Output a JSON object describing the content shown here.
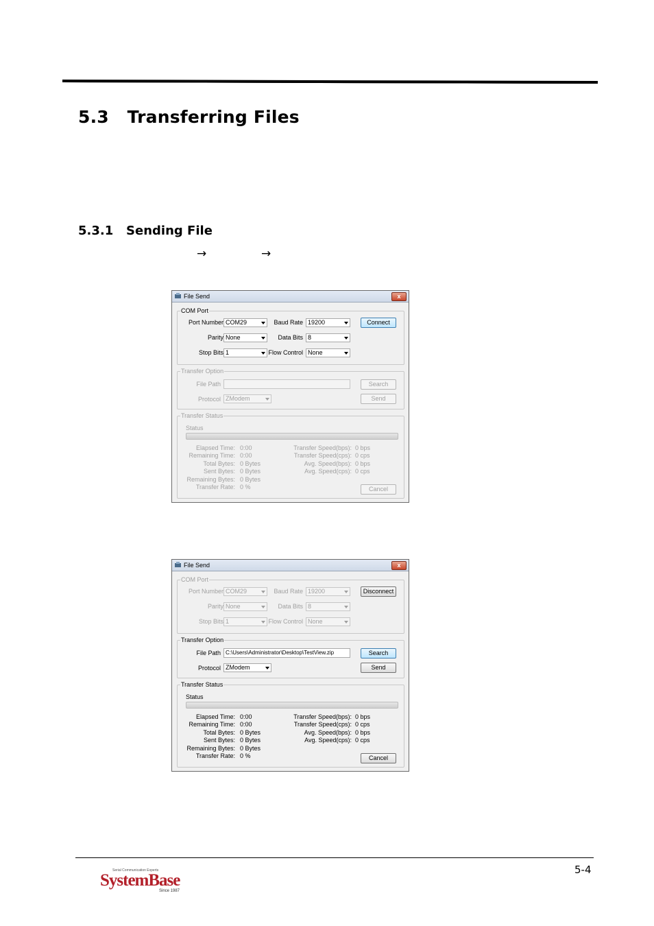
{
  "heading": "5.3   Transferring Files",
  "subheading": "5.3.1   Sending File",
  "arrows": [
    "→",
    "→"
  ],
  "page_number": "5-4",
  "logo": {
    "tagline": "Serial Communication Experts",
    "brand": "SystemBase",
    "since": "Since 1987"
  },
  "dialogs": [
    {
      "title": "File Send",
      "close": "x",
      "com_port": {
        "legend": "COM Port",
        "port_number_label": "Port Number",
        "port_number": "COM29",
        "baud_rate_label": "Baud Rate",
        "baud_rate": "19200",
        "parity_label": "Parity",
        "parity": "None",
        "data_bits_label": "Data Bits",
        "data_bits": "8",
        "stop_bits_label": "Stop Bits",
        "stop_bits": "1",
        "flow_control_label": "Flow Control",
        "flow_control": "None",
        "connect_button": "Connect"
      },
      "transfer_option": {
        "legend": "Transfer Option",
        "file_path_label": "File Path",
        "file_path": "",
        "protocol_label": "Protocol",
        "protocol": "ZModem",
        "search_button": "Search",
        "send_button": "Send"
      },
      "transfer_status": {
        "legend": "Transfer Status",
        "status_label": "Status",
        "elapsed_time_label": "Elapsed Time:",
        "elapsed_time": "0:00",
        "remaining_time_label": "Remaining Time:",
        "remaining_time": "0:00",
        "total_bytes_label": "Total Bytes:",
        "total_bytes": "0 Bytes",
        "sent_bytes_label": "Sent Bytes:",
        "sent_bytes": "0 Bytes",
        "remaining_bytes_label": "Remaining Bytes:",
        "remaining_bytes": "0 Bytes",
        "transfer_rate_label": "Transfer Rate:",
        "transfer_rate": "0 %",
        "speed_bps_label": "Transfer Speed(bps):",
        "speed_bps": "0 bps",
        "speed_cps_label": "Transfer Speed(cps):",
        "speed_cps": "0 cps",
        "avg_bps_label": "Avg. Speed(bps):",
        "avg_bps": "0 bps",
        "avg_cps_label": "Avg. Speed(cps):",
        "avg_cps": "0 cps",
        "cancel_button": "Cancel"
      }
    },
    {
      "title": "File Send",
      "close": "x",
      "com_port": {
        "legend": "COM Port",
        "port_number_label": "Port Number",
        "port_number": "COM29",
        "baud_rate_label": "Baud Rate",
        "baud_rate": "19200",
        "parity_label": "Parity",
        "parity": "None",
        "data_bits_label": "Data Bits",
        "data_bits": "8",
        "stop_bits_label": "Stop Bits",
        "stop_bits": "1",
        "flow_control_label": "Flow Control",
        "flow_control": "None",
        "connect_button": "Disconnect"
      },
      "transfer_option": {
        "legend": "Transfer Option",
        "file_path_label": "File Path",
        "file_path": "C:\\Users\\Administrator\\Desktop\\TestView.zip",
        "protocol_label": "Protocol",
        "protocol": "ZModem",
        "search_button": "Search",
        "send_button": "Send"
      },
      "transfer_status": {
        "legend": "Transfer Status",
        "status_label": "Status",
        "elapsed_time_label": "Elapsed Time:",
        "elapsed_time": "0:00",
        "remaining_time_label": "Remaining Time:",
        "remaining_time": "0:00",
        "total_bytes_label": "Total Bytes:",
        "total_bytes": "0 Bytes",
        "sent_bytes_label": "Sent Bytes:",
        "sent_bytes": "0 Bytes",
        "remaining_bytes_label": "Remaining Bytes:",
        "remaining_bytes": "0 Bytes",
        "transfer_rate_label": "Transfer Rate:",
        "transfer_rate": "0 %",
        "speed_bps_label": "Transfer Speed(bps):",
        "speed_bps": "0 bps",
        "speed_cps_label": "Transfer Speed(cps):",
        "speed_cps": "0 cps",
        "avg_bps_label": "Avg. Speed(bps):",
        "avg_bps": "0 bps",
        "avg_cps_label": "Avg. Speed(cps):",
        "avg_cps": "0 cps",
        "cancel_button": "Cancel"
      }
    }
  ]
}
